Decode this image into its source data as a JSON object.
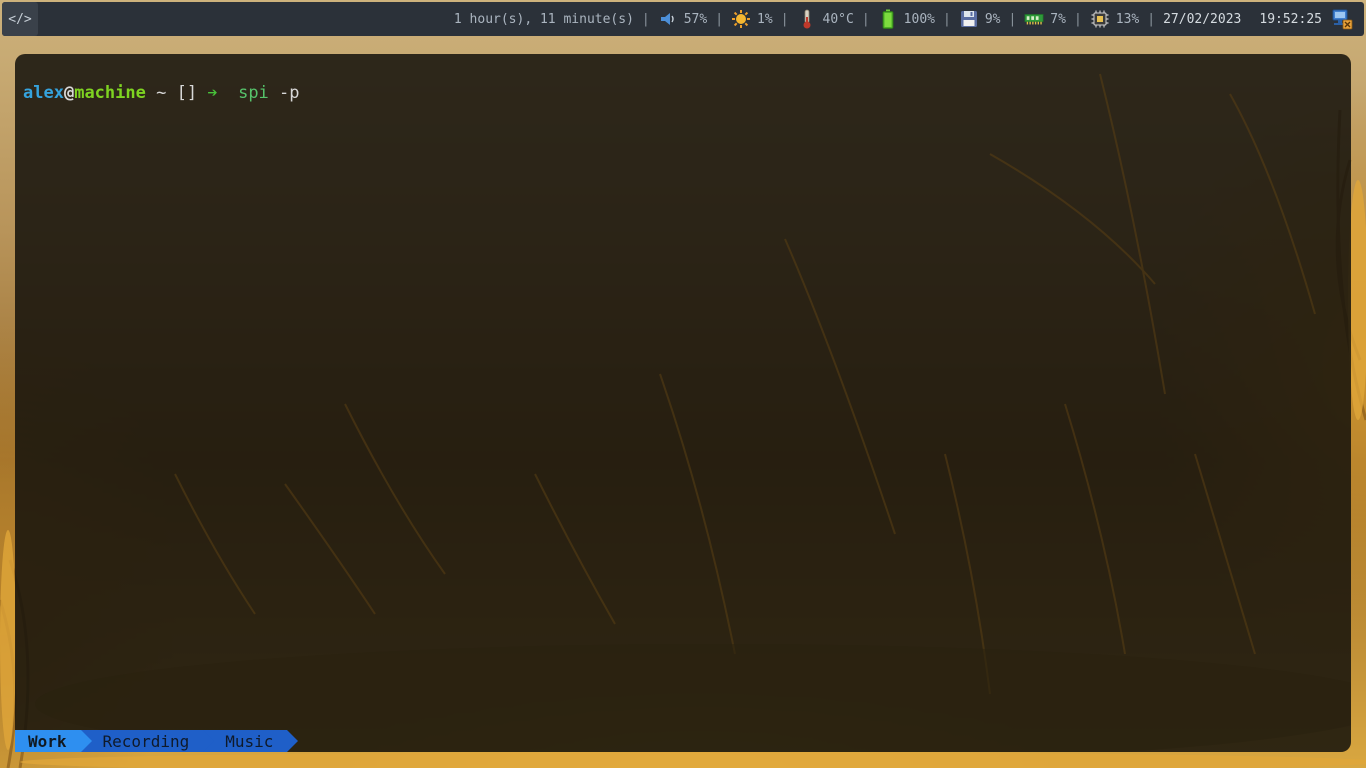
{
  "topbar": {
    "launcher_label": "</>",
    "uptime": "1 hour(s), 11 minute(s)",
    "volume": "57%",
    "brightness": "1%",
    "temperature": "40°C",
    "battery": "100%",
    "disk": "9%",
    "memory": "7%",
    "cpu": "13%",
    "date": "27/02/2023",
    "time": "19:52:25",
    "separator": "|",
    "icons": {
      "volume": "speaker-icon",
      "brightness": "sun-icon",
      "temperature": "thermometer-icon",
      "battery": "battery-icon",
      "disk": "floppy-disk-icon",
      "memory": "ram-icon",
      "cpu": "cpu-chip-icon",
      "network": "network-icon"
    }
  },
  "terminal": {
    "user": "alex",
    "at": "@",
    "host": "machine",
    "dir": "~",
    "git": "[]",
    "arrow": "➔",
    "command": "spi",
    "args": "-p"
  },
  "workspaces": [
    {
      "label": "Work",
      "active": true
    },
    {
      "label": "Recording",
      "active": false
    },
    {
      "label": "Music",
      "active": false
    }
  ],
  "colors": {
    "bar_bg": "#2b3139",
    "user": "#35a3dd",
    "host": "#7ed321",
    "arrow": "#48c23a",
    "tab_active": "#2e8ff0",
    "tab_inactive": "#1f5fc8"
  }
}
